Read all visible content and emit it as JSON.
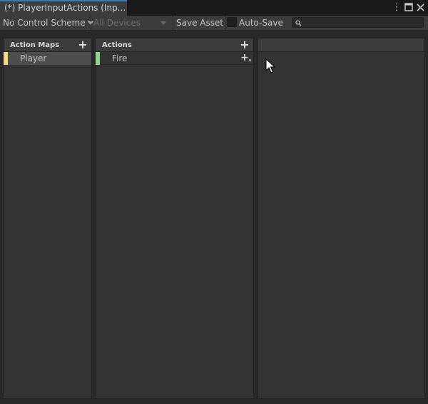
{
  "window": {
    "tab_title": "(*) PlayerInputActions (Inp...",
    "menu_icon": "vertical-ellipsis-icon",
    "maximize_icon": "maximize-icon",
    "close_icon": "close-icon"
  },
  "toolbar": {
    "control_scheme": "No Control Scheme",
    "devices": "All Devices",
    "save_asset": "Save Asset",
    "auto_save": "Auto-Save",
    "auto_save_checked": false,
    "search_placeholder": "",
    "search_icon": "search-icon"
  },
  "action_maps": {
    "header": "Action Maps",
    "add_icon": "plus-icon",
    "items": [
      {
        "label": "Player",
        "selected": true,
        "color": "#f2d98a"
      }
    ]
  },
  "actions": {
    "header": "Actions",
    "add_icon": "plus-icon",
    "items": [
      {
        "label": "Fire",
        "color": "#8fd48f",
        "add_binding_icon": "plus-dropdown-icon"
      }
    ]
  },
  "properties": {
    "header": ""
  },
  "colors": {
    "tab_accent": "#3a79bb",
    "selected_row": "#4d4d4d"
  }
}
